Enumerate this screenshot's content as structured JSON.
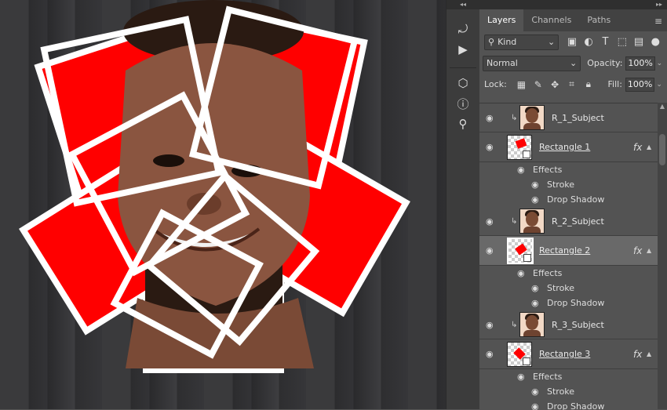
{
  "canvas": {
    "accent_red": "#ff0000",
    "frame_white": "#ffffff",
    "wood": "#333336"
  },
  "toolstrip": {
    "collapse_glyph": "◂◂",
    "tools": [
      {
        "name": "history-icon",
        "glyph": "⤾"
      },
      {
        "name": "play-actions-icon",
        "glyph": "▶"
      },
      {
        "name": "3d-cube-icon",
        "glyph": "⬡"
      },
      {
        "name": "info-icon",
        "glyph": "ⓘ"
      },
      {
        "name": "clone-source-icon",
        "glyph": "⚲"
      }
    ]
  },
  "panel": {
    "collapse_glyph": "▸▸",
    "tabs": [
      "Layers",
      "Channels",
      "Paths"
    ],
    "menu_glyph": "≡",
    "filter": {
      "kind_label": "Kind"
    },
    "blend_mode": "Normal",
    "opacity_label": "Opacity:",
    "opacity_value": "100%",
    "lock_label": "Lock:",
    "fill_label": "Fill:",
    "fill_value": "100%"
  },
  "layers": [
    {
      "name": "R_1_Subject",
      "type": "subject"
    },
    {
      "name": "Rectangle 1",
      "type": "shape",
      "fx": "fx",
      "effects_label": "Effects",
      "effects": [
        "Stroke",
        "Drop Shadow"
      ]
    },
    {
      "name": "R_2_Subject",
      "type": "subject"
    },
    {
      "name": "Rectangle 2",
      "type": "shape",
      "selected": true,
      "fx": "fx",
      "effects_label": "Effects",
      "effects": [
        "Stroke",
        "Drop Shadow"
      ]
    },
    {
      "name": "R_3_Subject",
      "type": "subject"
    },
    {
      "name": "Rectangle 3",
      "type": "shape",
      "fx": "fx",
      "effects_label": "Effects",
      "effects": [
        "Stroke",
        "Drop Shadow"
      ]
    }
  ]
}
